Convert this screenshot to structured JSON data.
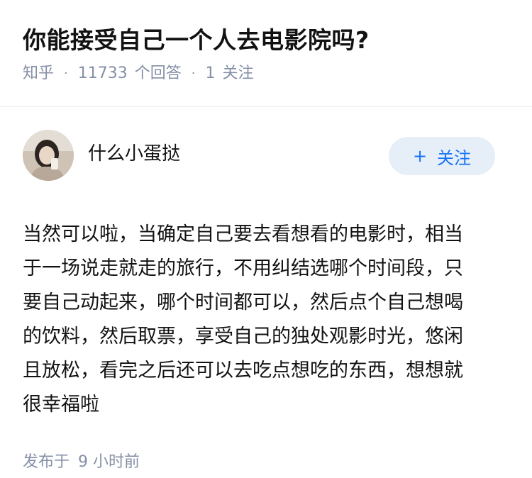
{
  "question": {
    "title": "你能接受自己一个人去电影院吗?",
    "source": "知乎",
    "answer_count": "11733",
    "answer_label": "个回答",
    "follow_count": "1",
    "follow_label": "关注"
  },
  "answer": {
    "author_name": "什么小蛋挞",
    "follow_button": "关注",
    "follow_icon": "plus-icon",
    "content": "当然可以啦，当确定自己要去看想看的电影时，相当于一场说走就走的旅行，不用纠结选哪个时间段，只要自己动起来，哪个时间都可以，然后点个自己想喝的饮料，然后取票，享受自己的独处观影时光，悠闲且放松，看完之后还可以去吃点想吃的东西，想想就很幸福啦",
    "published_label": "发布于",
    "published_time": "9 小时前"
  },
  "colors": {
    "meta_gray": "#8590a6",
    "follow_blue": "#1772f6",
    "follow_bg": "#e6eef8"
  }
}
